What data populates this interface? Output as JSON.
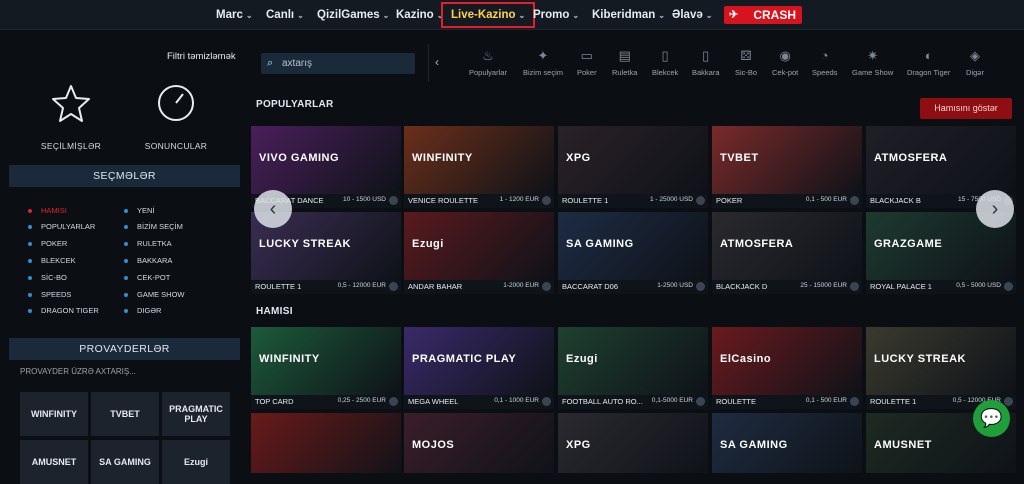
{
  "nav": {
    "items": [
      {
        "label": "Marc"
      },
      {
        "label": "Canlı"
      },
      {
        "label": "QizilGames"
      },
      {
        "label": "Kazino"
      },
      {
        "label": "Live-Kazino"
      },
      {
        "label": "Promo"
      },
      {
        "label": "Kiberidman"
      },
      {
        "label": "Əlavə"
      }
    ],
    "crash_label": "CRASH",
    "active_color": "#e3202a"
  },
  "left": {
    "filter_clear": "Filtri təmizləmək",
    "favorites_label": "SEÇİLMİŞLƏR",
    "recent_label": "SONUNCULAR",
    "choices_title": "SEÇMƏLƏR",
    "categories": [
      "HAMISI",
      "YENİ",
      "POPULYARLAR",
      "BİZİM SEÇİM",
      "POKER",
      "RULETKA",
      "BLEKCEK",
      "BAKKARA",
      "SİC-BO",
      "CEK-POT",
      "SPEEDS",
      "GAME SHOW",
      "DRAGON TIGER",
      "DIGƏR"
    ],
    "providers_title": "PROVAYDERLƏR",
    "provider_search": "PROVAYDER ÜZRƏ AXTARIŞ...",
    "providers": [
      "WINFINITY",
      "TVBET",
      "PRAGMATIC PLAY",
      "AMUSNET",
      "SA GAMING",
      "Ezugi"
    ]
  },
  "search": {
    "placeholder": "axtarış"
  },
  "catbar": {
    "items": [
      "Populyarlar",
      "Bizim seçim",
      "Poker",
      "Ruletka",
      "Blekcek",
      "Bakkara",
      "Sic-Bo",
      "Cek-pot",
      "Speeds",
      "Game Show",
      "Dragon Tiger",
      "Digər"
    ]
  },
  "popular": {
    "title": "POPULYARLAR",
    "show_all": "Hamısını göstər",
    "cards": [
      {
        "name": "BACCARAT DANCE",
        "limit": "10 - 1500 USD",
        "brand": "VIVO GAMING",
        "color": "#4a1f5a"
      },
      {
        "name": "VENICE ROULETTE",
        "limit": "1 - 1200 EUR",
        "brand": "WINFINITY",
        "color": "#6b2f1a"
      },
      {
        "name": "ROULETTE 1",
        "limit": "1 - 25000 USD",
        "brand": "XPG",
        "color": "#2a2228"
      },
      {
        "name": "POKER",
        "limit": "0,1 - 500 EUR",
        "brand": "TVBET",
        "color": "#7a2a2a"
      },
      {
        "name": "BLACKJACK B",
        "limit": "15 - 7500 USD",
        "brand": "ATMOSFERA",
        "color": "#1f1f26"
      },
      {
        "name": "ROULETTE 1",
        "limit": "0,5 - 12000 EUR",
        "brand": "LUCKY STREAK",
        "color": "#3a2d52"
      },
      {
        "name": "ANDAR BAHAR",
        "limit": "1-2000 EUR",
        "brand": "Ezugi",
        "color": "#5a1a1e"
      },
      {
        "name": "BACCARAT D06",
        "limit": "1-2500 USD",
        "brand": "SA GAMING",
        "color": "#1d2c44"
      },
      {
        "name": "BLACKJACK D",
        "limit": "25 - 15000 EUR",
        "brand": "ATMOSFERA",
        "color": "#2a2a2e"
      },
      {
        "name": "ROYAL PALACE 1",
        "limit": "0,5 - 5000 USD",
        "brand": "GRAZGAME",
        "color": "#1e3a30"
      }
    ]
  },
  "all": {
    "title": "HAMISI",
    "cards": [
      {
        "name": "TOP CARD",
        "limit": "0,25 - 2500 EUR",
        "brand": "WINFINITY",
        "color": "#1d5a3a"
      },
      {
        "name": "MEGA WHEEL",
        "limit": "0,1 - 1000 EUR",
        "brand": "PRAGMATIC PLAY",
        "color": "#3a2a6a"
      },
      {
        "name": "FOOTBALL AUTO RO...",
        "limit": "0,1-5000 EUR",
        "brand": "Ezugi",
        "color": "#1f4030"
      },
      {
        "name": "ROULETTE",
        "limit": "0,1 - 500 EUR",
        "brand": "ElCasino",
        "color": "#6a1a1e"
      },
      {
        "name": "ROULETTE 1",
        "limit": "0,5 - 12000 EUR",
        "brand": "LUCKY STREAK",
        "color": "#3a3a2e"
      },
      {
        "name": "",
        "limit": "",
        "brand": "",
        "color": "#6a1a1a"
      },
      {
        "name": "",
        "limit": "",
        "brand": "MOJOS",
        "color": "#3a1e2a"
      },
      {
        "name": "",
        "limit": "",
        "brand": "XPG",
        "color": "#2a2a30"
      },
      {
        "name": "",
        "limit": "",
        "brand": "SA GAMING",
        "color": "#1e2c40"
      },
      {
        "name": "",
        "limit": "",
        "brand": "AMUSNET",
        "color": "#1e2a22"
      }
    ]
  }
}
